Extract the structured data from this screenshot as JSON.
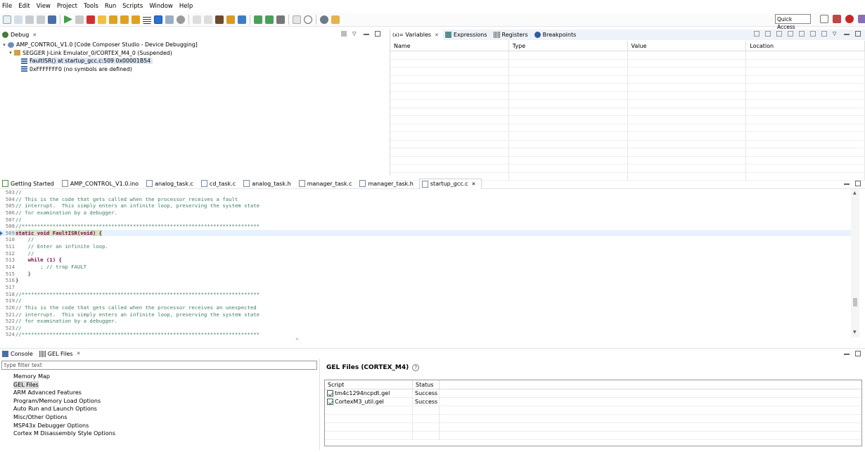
{
  "menu": [
    "File",
    "Edit",
    "View",
    "Project",
    "Tools",
    "Run",
    "Scripts",
    "Window",
    "Help"
  ],
  "quick_access": "Quick Access",
  "debug": {
    "tab_label": "Debug",
    "tree": {
      "root": "AMP_CONTROL_V1.0 [Code Composer Studio - Device Debugging]",
      "emulator": "SEGGER J-Link Emulator_0/CORTEX_M4_0 (Suspended)",
      "frames": [
        "FaultISR() at startup_gcc.c:509 0x00001B54",
        "0xFFFFFFF0  (no symbols are defined)"
      ]
    }
  },
  "variables_view": {
    "tabs": [
      "Variables",
      "Expressions",
      "Registers",
      "Breakpoints"
    ],
    "columns": [
      "Name",
      "Type",
      "Value",
      "Location"
    ]
  },
  "editor": {
    "tabs": [
      "Getting Started",
      "AMP_CONTROL_V1.0.ino",
      "analog_task.c",
      "cd_task.c",
      "analog_task.h",
      "manager_task.c",
      "manager_task.h",
      "startup_gcc.c"
    ],
    "active_tab": "startup_gcc.c",
    "lines": [
      {
        "n": "503",
        "t": "//"
      },
      {
        "n": "504",
        "t": "// This is the code that gets called when the processor receives a fault"
      },
      {
        "n": "505",
        "t": "// interrupt.  This simply enters an infinite loop, preserving the system state"
      },
      {
        "n": "506",
        "t": "// for examination by a debugger."
      },
      {
        "n": "507",
        "t": "//"
      },
      {
        "n": "508",
        "t": "//*****************************************************************************"
      },
      {
        "n": "509",
        "t": "static void FaultISR(void) {"
      },
      {
        "n": "510",
        "t": "    //"
      },
      {
        "n": "511",
        "t": "    // Enter an infinite loop."
      },
      {
        "n": "512",
        "t": "    //"
      },
      {
        "n": "513",
        "t": "    while (1) {"
      },
      {
        "n": "514",
        "t": "        ; // trap FAULT"
      },
      {
        "n": "515",
        "t": "    }"
      },
      {
        "n": "516",
        "t": "}"
      },
      {
        "n": "517",
        "t": ""
      },
      {
        "n": "518",
        "t": "//*****************************************************************************"
      },
      {
        "n": "519",
        "t": "//"
      },
      {
        "n": "520",
        "t": "// This is the code that gets called when the processor receives an unexpected"
      },
      {
        "n": "521",
        "t": "// interrupt.  This simply enters an infinite loop, preserving the system state"
      },
      {
        "n": "522",
        "t": "// for examination by a debugger."
      },
      {
        "n": "523",
        "t": "//"
      },
      {
        "n": "524",
        "t": "//*****************************************************************************"
      }
    ]
  },
  "bottom": {
    "tabs": [
      "Console",
      "GEL Files"
    ],
    "filter_placeholder": "type filter text",
    "nav": [
      "Memory Map",
      "GEL Files",
      "ARM Advanced Features",
      "Program/Memory Load Options",
      "Auto Run and Launch Options",
      "Misc/Other Options",
      "MSP43x Debugger Options",
      "Cortex M Disassembly Style Options"
    ],
    "selected_nav": "GEL Files",
    "gel_title": "GEL Files (CORTEX_M4)",
    "help": "?",
    "columns": [
      "Script",
      "Status"
    ],
    "rows": [
      {
        "script": "tm4c1294ncpdt.gel",
        "status": "Success"
      },
      {
        "script": "CortexM3_util.gel",
        "status": "Success"
      }
    ]
  },
  "colors": {
    "accent": "#3c6eb4",
    "selection": "#dbe6f4",
    "comment": "#3f7f5f",
    "keyword": "#7f0055",
    "success_check": "#1d8a3a"
  }
}
